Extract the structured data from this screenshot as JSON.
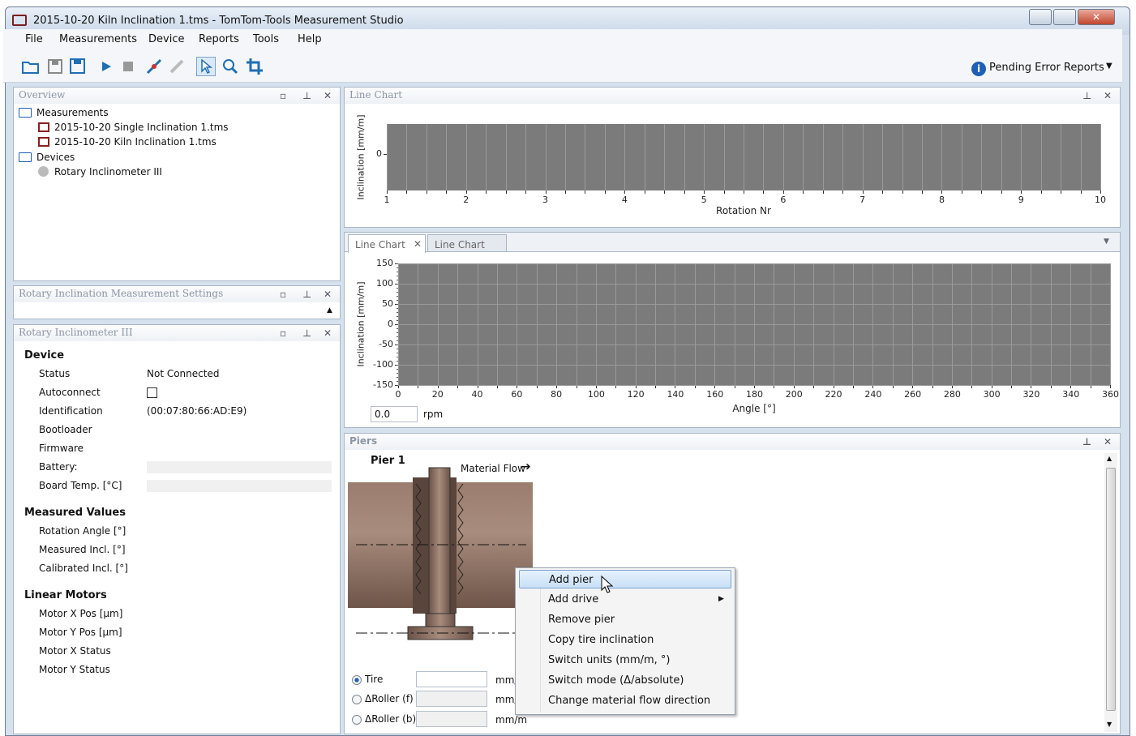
{
  "window": {
    "title": "2015-10-20 Kiln Inclination 1.tms - TomTom-Tools Measurement Studio"
  },
  "menu": [
    "File",
    "Measurements",
    "Device",
    "Reports",
    "Tools",
    "Help"
  ],
  "toolbar": {
    "pending_reports": "Pending Error Reports"
  },
  "overview": {
    "title": "Overview",
    "measurements_label": "Measurements",
    "measurement_items": [
      "2015-10-20 Single Inclination 1.tms",
      "2015-10-20 Kiln Inclination 1.tms"
    ],
    "devices_label": "Devices",
    "device_items": [
      "Rotary Inclinometer III"
    ]
  },
  "settings_panel": {
    "title": "Rotary Inclination Measurement Settings"
  },
  "device_panel": {
    "title": "Rotary Inclinometer III",
    "device_section": "Device",
    "status_label": "Status",
    "status_value": "Not Connected",
    "autoconnect_label": "Autoconnect",
    "identification_label": "Identification",
    "identification_value": "(00:07:80:66:AD:E9)",
    "bootloader_label": "Bootloader",
    "firmware_label": "Firmware",
    "battery_label": "Battery:",
    "board_temp_label": "Board Temp. [°C]",
    "measured_section": "Measured Values",
    "rotation_angle_label": "Rotation Angle [°]",
    "measured_incl_label": "Measured Incl. [°]",
    "calibrated_incl_label": "Calibrated Incl. [°]",
    "motors_section": "Linear Motors",
    "motor_x_pos_label": "Motor X Pos [µm]",
    "motor_y_pos_label": "Motor Y Pos [µm]",
    "motor_x_status_label": "Motor X Status",
    "motor_y_status_label": "Motor Y Status"
  },
  "line_chart_top": {
    "title": "Line Chart"
  },
  "chart_tabs": [
    "Line Chart",
    "Line Chart"
  ],
  "rpm": {
    "value": "0.0",
    "unit": "rpm"
  },
  "chart_data": [
    {
      "type": "line",
      "xlabel": "Rotation Nr",
      "ylabel": "Inclination [mm/m]",
      "x_ticks": [
        "1",
        "2",
        "3",
        "4",
        "5",
        "6",
        "7",
        "8",
        "9",
        "10"
      ],
      "y_ticks": [
        "0"
      ],
      "xlim": [
        1,
        10
      ],
      "grid": true,
      "series": []
    },
    {
      "type": "line",
      "xlabel": "Angle [°]",
      "ylabel": "Inclination [mm/m]",
      "x_ticks": [
        "0",
        "20",
        "40",
        "60",
        "80",
        "100",
        "120",
        "140",
        "160",
        "180",
        "200",
        "220",
        "240",
        "260",
        "280",
        "300",
        "320",
        "340",
        "360"
      ],
      "y_ticks": [
        "150",
        "100",
        "50",
        "0",
        "-50",
        "-100",
        "-150"
      ],
      "xlim": [
        0,
        360
      ],
      "ylim": [
        -150,
        150
      ],
      "grid": true,
      "series": []
    }
  ],
  "piers": {
    "title": "Piers",
    "pier_label": "Pier 1",
    "material_flow": "Material Flow",
    "tire_label": "Tire",
    "roller_f_label": "ΔRoller (f)",
    "roller_b_label": "ΔRoller (b)",
    "unit_1": "mm/",
    "unit_2": "mm/",
    "unit_3": "mm/m"
  },
  "context_menu": {
    "items": [
      "Add pier",
      "Add drive",
      "Remove pier",
      "Copy tire inclination",
      "Switch units (mm/m, °)",
      "Switch mode (Δ/absolute)",
      "Change material flow direction"
    ]
  },
  "colors": {
    "chart_bg": "#7b7b7b",
    "kiln": "#8a6d5f",
    "highlight": "#cfe3f8"
  }
}
